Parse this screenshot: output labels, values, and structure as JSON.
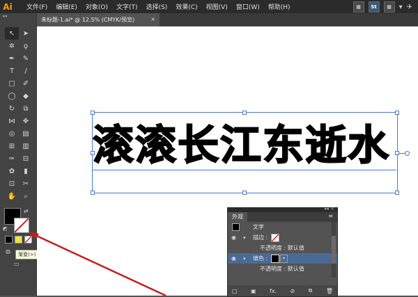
{
  "app": {
    "logo": "Ai"
  },
  "menu": [
    "文件(F)",
    "编辑(E)",
    "对象(O)",
    "文字(T)",
    "选择(S)",
    "效果(C)",
    "视图(V)",
    "窗口(W)",
    "帮助(H)"
  ],
  "menu_right": {
    "layout_label": "▦",
    "st_label": "St",
    "grid_label": "▦"
  },
  "document_tab": {
    "title": "未标题-1.ai* @ 12.5% (CMYK/预览)",
    "close": "×"
  },
  "canvas": {
    "text": "滚滚长江东逝水"
  },
  "tooltip": "渐变(>)",
  "appearance_panel": {
    "title": "外观",
    "object_label": "文字",
    "stroke_label": "描边 :",
    "opacity1": "不透明度 : 默认值",
    "fill_label": "填色 :",
    "opacity2": "不透明度 : 默认值",
    "footer_fx": "fx."
  },
  "colors": {
    "arrow": "#c81c1c",
    "selection": "#4a77d4",
    "highlight_row": "#4a6a94"
  }
}
